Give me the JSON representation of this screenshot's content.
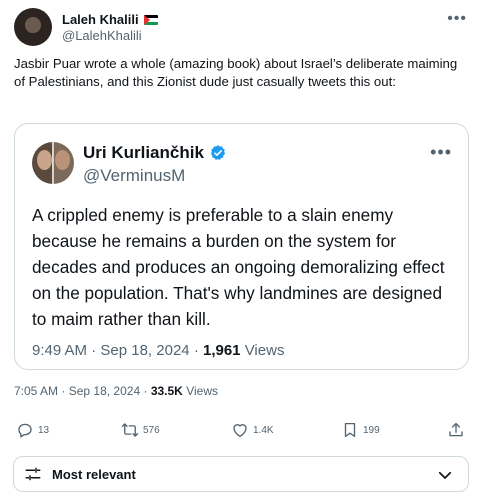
{
  "author": {
    "name": "Laleh Khalili",
    "handle": "@LalehKhalili"
  },
  "tweet": {
    "text": "Jasbir Puar wrote a whole (amazing book) about Israel’s deliberate maiming of Palestinians, and this Zionist dude just casually tweets this out:",
    "time": "7:05 AM",
    "date": "Sep 18, 2024",
    "views_count": "33.5K",
    "views_label": "Views"
  },
  "quoted": {
    "name": "Uri Kurliančhik",
    "handle": "@VerminusM",
    "text": "A crippled enemy is preferable to a slain enemy because he remains a burden on the system for decades and produces an ongoing demoralizing effect on the population. That's why landmines are designed to maim rather than kill.",
    "time": "9:49 AM",
    "date": "Sep 18, 2024",
    "views_count": "1,961",
    "views_label": "Views"
  },
  "actions": {
    "replies": "13",
    "reposts": "576",
    "likes": "1.4K",
    "bookmarks": "199"
  },
  "sort": {
    "label": "Most relevant"
  },
  "colors": {
    "text": "#0f1419",
    "secondary": "#536471",
    "border": "#cfd9de",
    "verified": "#1d9bf0"
  }
}
